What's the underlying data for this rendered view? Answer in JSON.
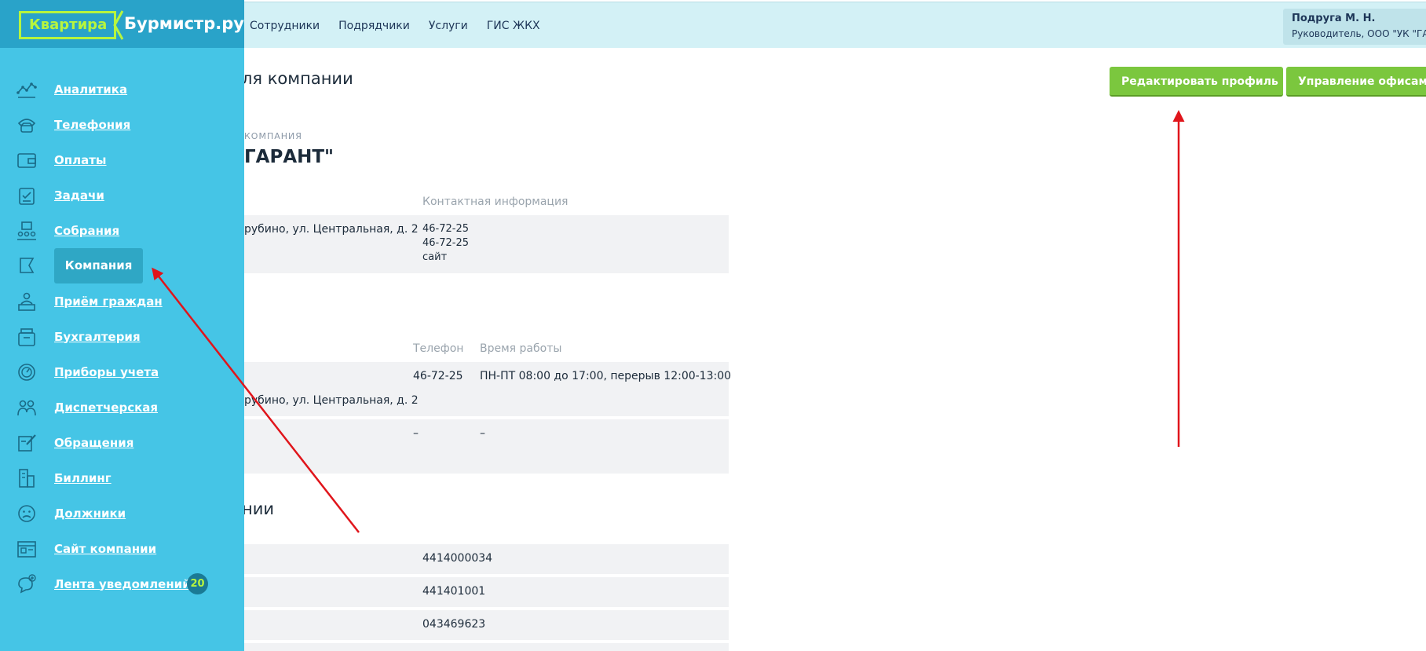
{
  "logo": {
    "part1": "Квартира",
    "part2": "Бурмистр.ру"
  },
  "topnav": [
    "Сотрудники",
    "Подрядчики",
    "Услуги",
    "ГИС ЖКХ"
  ],
  "user": {
    "name": "Подруга М. Н.",
    "role": "Руководитель, ООО \"УК \"ГАРАНТ\""
  },
  "sidebar": {
    "items": [
      {
        "label": "Аналитика",
        "icon": "analytics-icon"
      },
      {
        "label": "Телефония",
        "icon": "phone-icon"
      },
      {
        "label": "Оплаты",
        "icon": "wallet-icon"
      },
      {
        "label": "Задачи",
        "icon": "tasks-icon"
      },
      {
        "label": "Собрания",
        "icon": "meetings-icon"
      },
      {
        "label": "Компания",
        "icon": "flag-icon",
        "active": true
      },
      {
        "label": "Приём граждан",
        "icon": "reception-icon"
      },
      {
        "label": "Бухгалтерия",
        "icon": "accounting-icon"
      },
      {
        "label": "Приборы учета",
        "icon": "meter-icon"
      },
      {
        "label": "Диспетчерская",
        "icon": "dispatch-icon"
      },
      {
        "label": "Обращения",
        "icon": "requests-icon"
      },
      {
        "label": "Биллинг",
        "icon": "billing-icon"
      },
      {
        "label": "Должники",
        "icon": "debtors-icon"
      },
      {
        "label": "Сайт компании",
        "icon": "website-icon"
      },
      {
        "label": "Лента уведомлений",
        "icon": "notifications-icon",
        "badge": "20"
      }
    ]
  },
  "main": {
    "page_title": "ля компании",
    "company_label": "КОМПАНИЯ",
    "company_name": "ГАРАНТ\"",
    "edit_profile_button": "Редактировать профиль",
    "manage_offices_button": "Управление офисами",
    "contacts_table": {
      "header": "Контактная информация",
      "address": "рубино, ул. Центральная, д. 2",
      "phones": [
        "46-72-25",
        "46-72-25"
      ],
      "site": "сайт"
    },
    "offices_table": {
      "headers": {
        "phone": "Телефон",
        "hours": "Время работы"
      },
      "rows": [
        {
          "address": "рубино, ул. Центральная, д. 2",
          "phone": "46-72-25",
          "hours": "ПН-ПТ 08:00 до 17:00, перерыв 12:00-13:00"
        },
        {
          "address": "",
          "phone": "–",
          "hours": "–"
        }
      ]
    },
    "requisites_title": "нии",
    "requisites": [
      "4414000034",
      "441401001",
      "043469623"
    ]
  },
  "colors": {
    "sidebar": "#45c5e6",
    "accent": "#b7f53e",
    "button": "#7bc73e",
    "arrow": "#e0151b"
  }
}
